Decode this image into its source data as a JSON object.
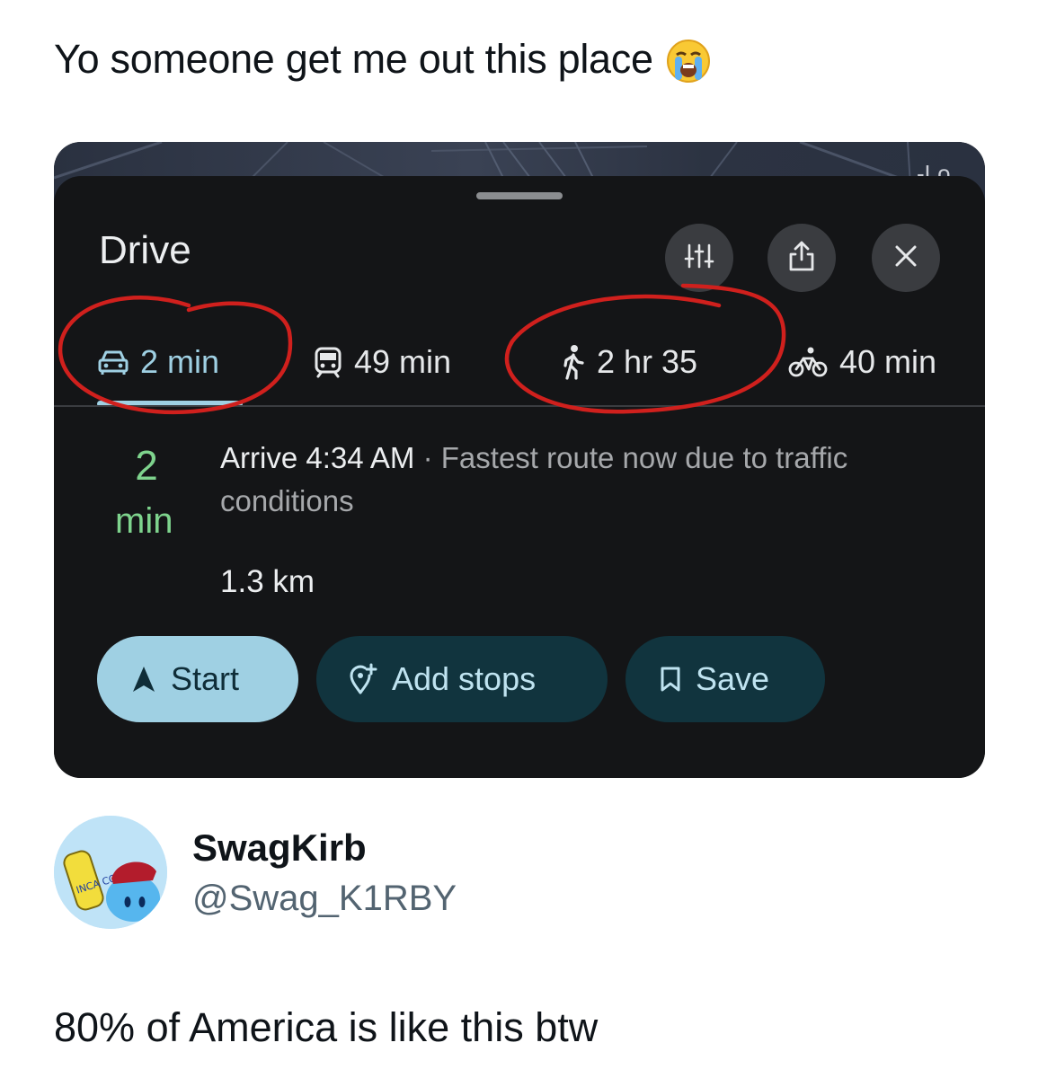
{
  "post": {
    "caption_top": "Yo someone get me out this place",
    "caption_emoji": "loudly-crying-face-emoji",
    "caption_bottom": "80% of America is like this btw"
  },
  "author": {
    "display_name": "SwagKirb",
    "handle": "@Swag_K1RBY",
    "avatar_label": "INCA COLA"
  },
  "map": {
    "corner_label": "-Lo"
  },
  "directions": {
    "title": "Drive",
    "header_buttons": [
      {
        "name": "route-options",
        "icon": "sliders-icon"
      },
      {
        "name": "share",
        "icon": "share-icon"
      },
      {
        "name": "close",
        "icon": "close-icon"
      }
    ],
    "modes": [
      {
        "icon": "car-icon",
        "label": "2 min",
        "active": true
      },
      {
        "icon": "transit-icon",
        "label": "49 min",
        "active": false
      },
      {
        "icon": "walk-icon",
        "label": "2 hr 35",
        "active": false
      },
      {
        "icon": "bike-icon",
        "label": "40 min",
        "active": false
      }
    ],
    "route": {
      "duration_value": "2",
      "duration_unit": "min",
      "arrive": "Arrive 4:34 AM",
      "separator": "·",
      "note": "Fastest route now due to traffic conditions",
      "distance": "1.3 km"
    },
    "actions": {
      "start": "Start",
      "add_stops": "Add stops",
      "save": "Save"
    }
  },
  "colors": {
    "accent": "#9fd0e3",
    "eta_green": "#7ed38d",
    "annotation_red": "#d0201d",
    "sheet_bg": "#141517"
  }
}
